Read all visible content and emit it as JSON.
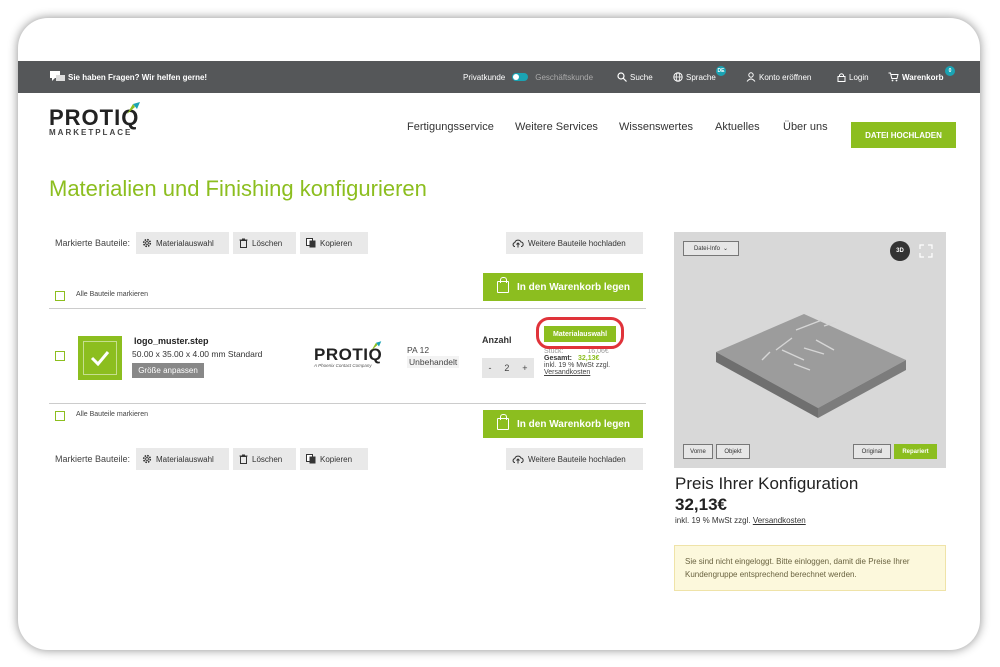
{
  "topbar": {
    "help": "Sie haben Fragen? Wir helfen gerne!",
    "private": "Privatkunde",
    "business": "Geschäftskunde",
    "search": "Suche",
    "language": "Sprache",
    "language_badge": "DE",
    "register": "Konto eröffnen",
    "login": "Login",
    "cart": "Warenkorb",
    "cart_count": "0"
  },
  "header": {
    "logo_main": "PROTIQ",
    "logo_sub": "MARKETPLACE",
    "nav": [
      "Fertigungsservice",
      "Weitere Services",
      "Wissenswertes",
      "Aktuelles",
      "Über uns"
    ],
    "upload_button": "DATEI HOCHLADEN"
  },
  "page": {
    "title": "Materialien und Finishing konfigurieren"
  },
  "toolbar": {
    "label": "Markierte Bauteile:",
    "material": "Materialauswahl",
    "delete": "Löschen",
    "copy": "Kopieren",
    "upload_more": "Weitere Bauteile hochladen"
  },
  "list": {
    "select_all": "Alle Bauteile markieren",
    "add_to_cart": "In den Warenkorb legen"
  },
  "part": {
    "name": "logo_muster.step",
    "dimensions": "50.00 x 35.00 x 4.00 mm Standard",
    "resize": "Größe anpassen",
    "brand_main": "PROTIQ",
    "brand_sub": "A Phoenix Contact Company",
    "material": "PA 12",
    "finish": "Unbehandelt",
    "qty_label": "Anzahl",
    "qty_minus": "-",
    "qty_value": "2",
    "qty_plus": "+",
    "material_button": "Materialauswahl",
    "unit_price_label": "Stück:",
    "unit_price": "16,06€",
    "total_label": "Gesamt:",
    "total": "32,13€",
    "vat_note": "inkl. 19 % MwSt zzgl.",
    "shipping": "Versandkosten"
  },
  "viewer": {
    "file_info": "Datei-Info",
    "badge_3d": "3D",
    "front": "Vorne",
    "object": "Objekt",
    "original": "Original",
    "repaired": "Repariert"
  },
  "summary": {
    "title": "Preis Ihrer Konfiguration",
    "price": "32,13€",
    "vat_note": "inkl. 19 % MwSt zzgl.",
    "shipping": "Versandkosten",
    "notice": "Sie sind nicht eingeloggt. Bitte einloggen, damit die Preise Ihrer Kundengruppe entsprechend berechnet werden."
  },
  "colors": {
    "accent": "#8cbe1f",
    "topbar": "#555759",
    "highlight": "#e0333a",
    "toggle": "#1aa3b3"
  }
}
